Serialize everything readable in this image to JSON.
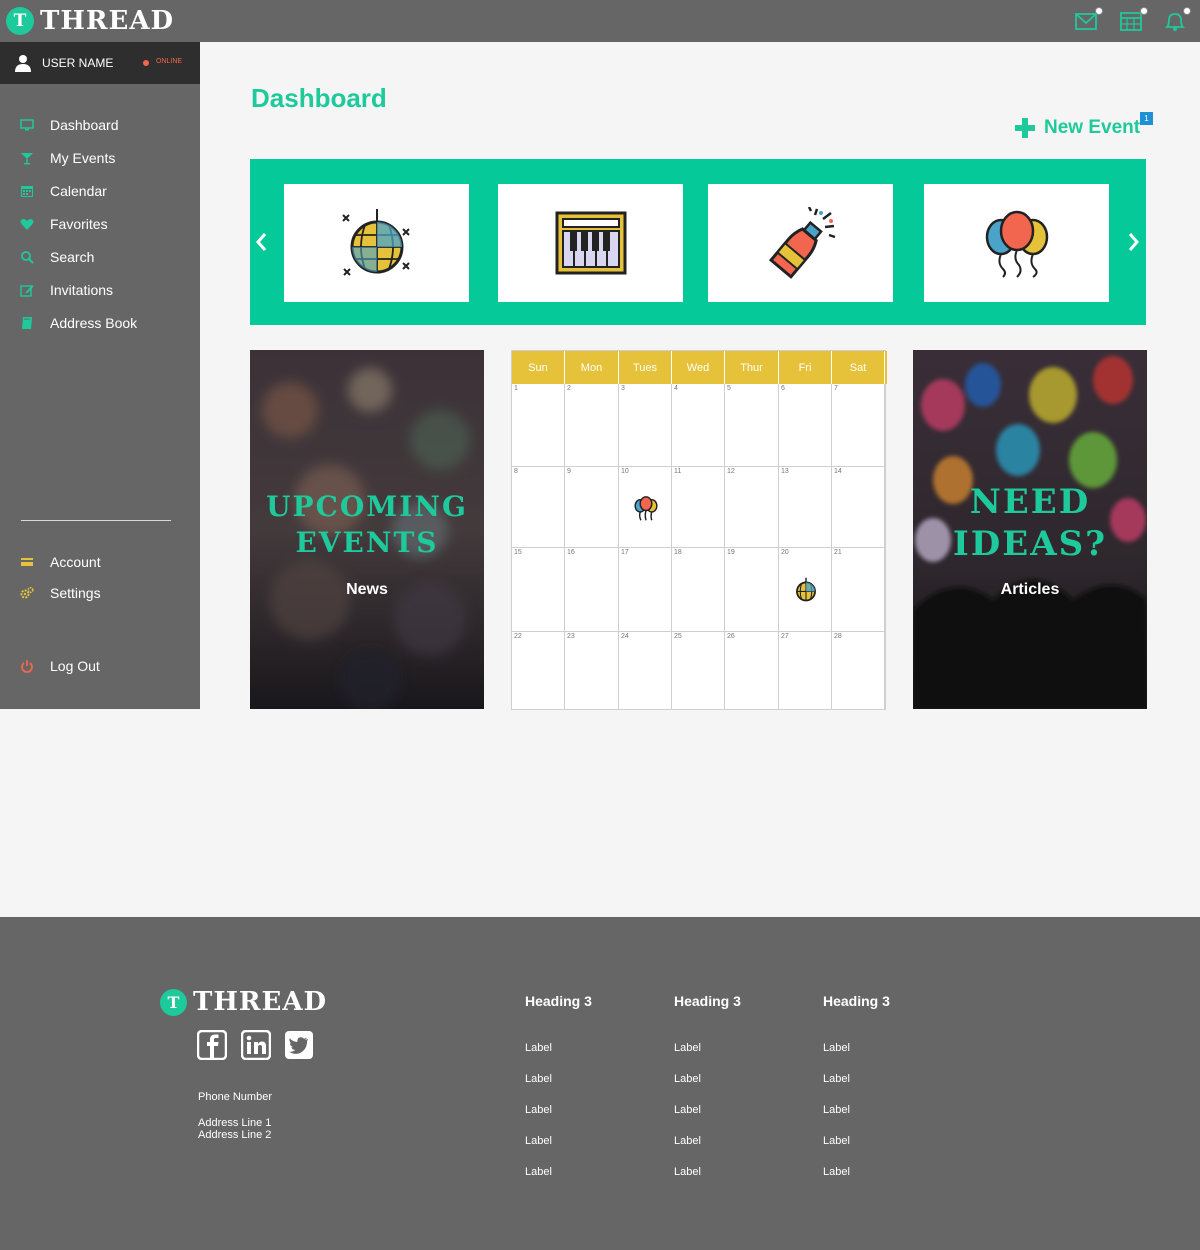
{
  "brand": {
    "name": "THREAD",
    "badge": "T"
  },
  "header": {
    "icons": [
      "mail-icon",
      "calendar-icon",
      "bell-icon"
    ],
    "accent": "#1ec99b"
  },
  "user": {
    "name": "USER NAME",
    "status": "ONLINE"
  },
  "sidebar": {
    "items": [
      {
        "label": "Dashboard",
        "icon": "monitor-icon"
      },
      {
        "label": "My Events",
        "icon": "cocktail-icon"
      },
      {
        "label": "Calendar",
        "icon": "calendar-icon"
      },
      {
        "label": "Favorites",
        "icon": "heart-icon"
      },
      {
        "label": "Search",
        "icon": "search-icon"
      },
      {
        "label": "Invitations",
        "icon": "edit-icon"
      },
      {
        "label": "Address Book",
        "icon": "book-icon"
      }
    ],
    "bottom_items": [
      {
        "label": "Account",
        "icon": "card-icon"
      },
      {
        "label": "Settings",
        "icon": "gears-icon"
      },
      {
        "label": "Log Out",
        "icon": "power-icon"
      }
    ]
  },
  "main": {
    "title": "Dashboard",
    "new_event_label": "New Event",
    "new_event_badge": "1",
    "carousel": {
      "items": [
        "disco-ball-icon",
        "keyboard-icon",
        "champagne-icon",
        "balloons-icon"
      ]
    },
    "cards": {
      "upcoming": {
        "heading_line1": "UPCOMING",
        "heading_line2": "EVENTS",
        "sub": "News"
      },
      "ideas": {
        "heading_line1": "NEED",
        "heading_line2": "IDEAS?",
        "sub": "Articles"
      }
    },
    "calendar": {
      "days": [
        "Sun",
        "Mon",
        "Tues",
        "Wed",
        "Thur",
        "Fri",
        "Sat"
      ],
      "dates": [
        "1",
        "2",
        "3",
        "4",
        "5",
        "6",
        "7",
        "8",
        "9",
        "10",
        "11",
        "12",
        "13",
        "14",
        "15",
        "16",
        "17",
        "18",
        "19",
        "20",
        "21",
        "22",
        "23",
        "24",
        "25",
        "26",
        "27",
        "28"
      ],
      "events": [
        {
          "date": "10",
          "icon": "balloons-icon"
        },
        {
          "date": "20",
          "icon": "disco-ball-icon"
        }
      ],
      "header_color": "#e6c23a"
    }
  },
  "footer": {
    "phone": "Phone Number",
    "address_line1": "Address Line 1",
    "address_line2": "Address Line 2",
    "social": [
      "facebook-icon",
      "linkedin-icon",
      "twitter-icon"
    ],
    "columns": [
      {
        "heading": "Heading 3",
        "links": [
          "Label",
          "Label",
          "Label",
          "Label",
          "Label"
        ]
      },
      {
        "heading": "Heading 3",
        "links": [
          "Label",
          "Label",
          "Label",
          "Label",
          "Label"
        ]
      },
      {
        "heading": "Heading 3",
        "links": [
          "Label",
          "Label",
          "Label",
          "Label",
          "Label"
        ]
      }
    ]
  }
}
